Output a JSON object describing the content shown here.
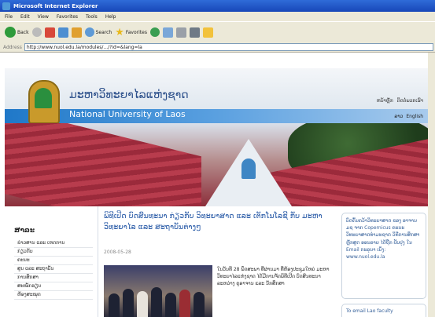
{
  "window": {
    "title": "Microsoft Internet Explorer"
  },
  "menu": [
    "File",
    "Edit",
    "View",
    "Favorites",
    "Tools",
    "Help"
  ],
  "toolbar": {
    "back_label": "Back",
    "search_label": "Search",
    "favorites_label": "Favorites"
  },
  "address": {
    "label": "Address",
    "url": "http://www.nuol.edu.la/modules/.../?id=&lang=la"
  },
  "site": {
    "title_lao": "ມະຫາວິທະຍາໄລແຫ່ງຊາດ",
    "title_en": "National University of Laos",
    "header_links": [
      "ຫນ້າຫຼັກ",
      "ຕິດຕໍ່ພວກເຮົາ"
    ],
    "languages": [
      "ລາວ",
      "English"
    ]
  },
  "sidebar": {
    "heading": "ສາລະ",
    "items": [
      "ຂ່າວສານ ແລະ ເຫດການ",
      "ກ່ຽວກັບ",
      "ຄະນະ",
      "ສູນ ແລະ ສະຖາບັນ",
      "ການສຶກສາ",
      "ສະໝັກຮຽນ",
      "ຫ້ອງສະໝຸດ"
    ]
  },
  "news": {
    "headline": "ພິທີເປີດ ບົດສົນທະນາ ກ່ຽວກັບ ວິທະຍາສາດ ແລະ ເຕັກໂນໂລຊີ ກັບ ມະຫາວິທະຍາໄລ ແລະ ສະຖາບັນຕ່າງໆ",
    "date": "2008-05-28",
    "body": "ໃນວັນທີ 28 ພຶດສະພາ ທີ່ຜ່ານມາ ທີ່ຫ້ອງປະຊຸມໃຫຍ່ ມະຫາວິທະຍາໄລແຫ່ງຊາດ ໄດ້ມີການຈັດພິທີເປີດ ບົດສົນທະນາ ລະຫວ່າງ ຄູອາຈານ ແລະ ນັກສຶກສາ"
  },
  "info": {
    "box1": "ບົດຄົ້ນຄວ້າວິທະຍາສາດ ຂອງ ອາຈານ ມຊ ຈາກ Copernicus ຄະນະວິທະຍາສາດທຳມະຊາດ ວິທີການສຶກສາ ຫຼັກສູດ ອອນລາຍ ໄດ້ຖືກ ປັບປຸງ ໃນ Email ກະລຸນາ ເບິ່ງ: www.nuol.edu.la",
    "box2": "To email Lao faculty"
  },
  "colors": {
    "accent_blue": "#1f78c8",
    "title_blue": "#2a4e8a",
    "roof_red": "#9b2a3b"
  }
}
